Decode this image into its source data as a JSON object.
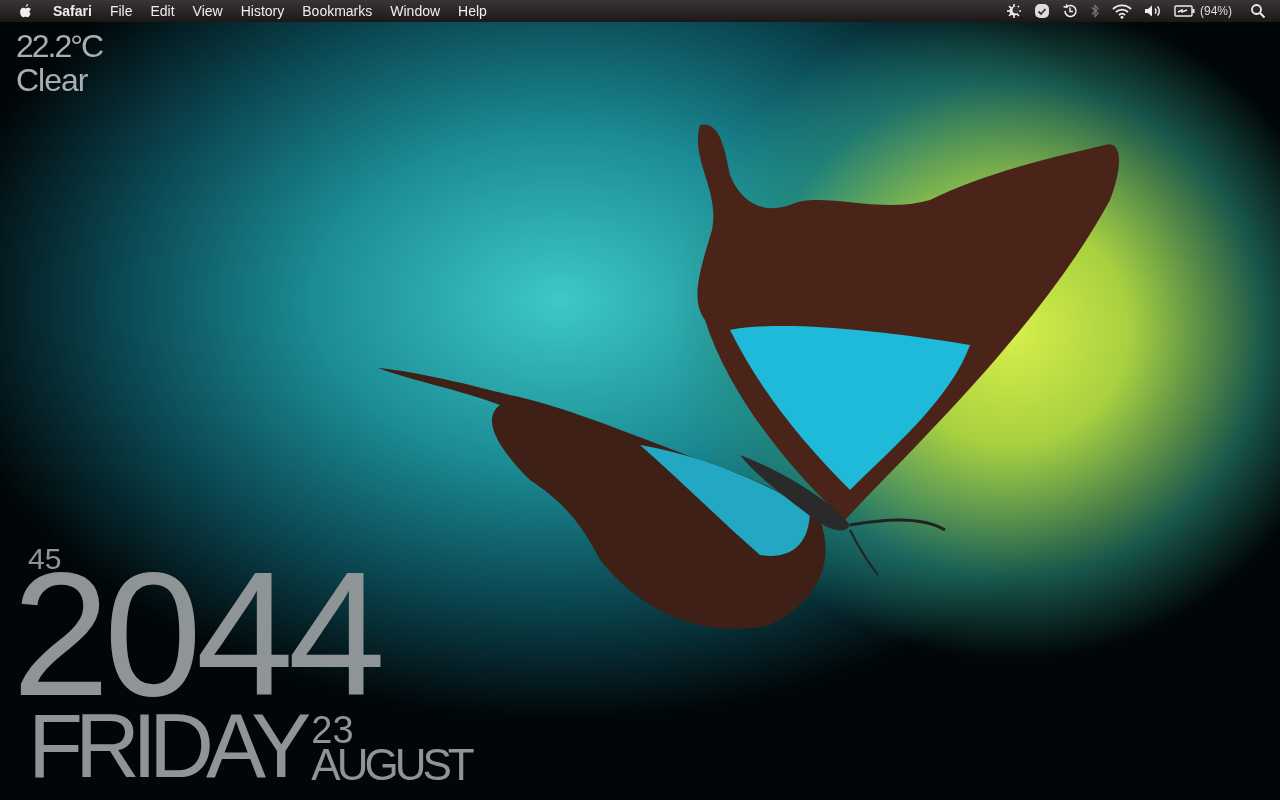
{
  "menu_bar": {
    "app_name": "Safari",
    "menus": [
      "File",
      "Edit",
      "View",
      "History",
      "Bookmarks",
      "Window",
      "Help"
    ],
    "battery_text": "(94%)"
  },
  "weather": {
    "temperature": "22.2°C",
    "condition": "Clear"
  },
  "clock": {
    "seconds": "45",
    "time": "2044"
  },
  "date": {
    "weekday": "FRIDAY",
    "day": "23",
    "month": "AUGUST"
  }
}
